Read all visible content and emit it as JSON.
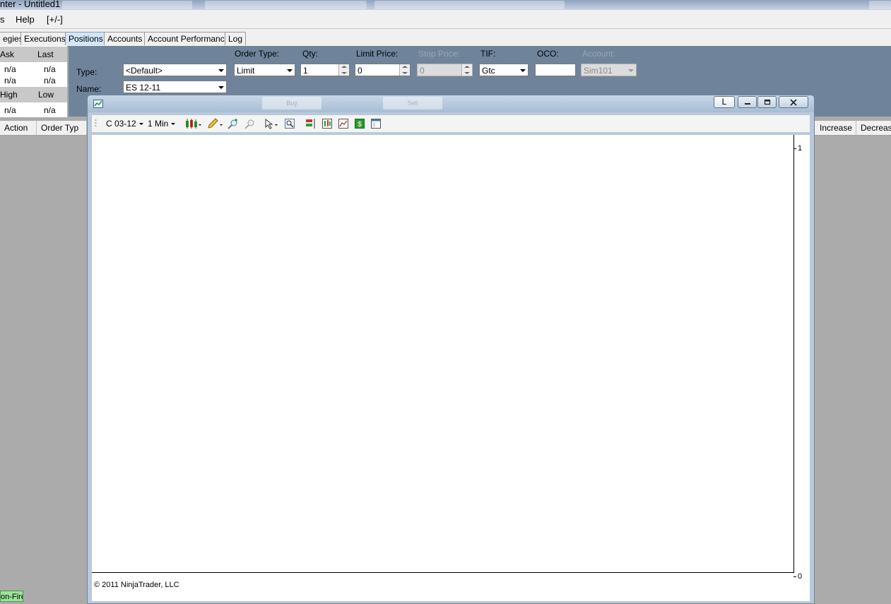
{
  "window": {
    "title": "nter - Untitled1",
    "taskbar_ghosts": [
      "",
      "",
      "",
      ""
    ]
  },
  "menu": {
    "items": [
      "s",
      "Help",
      "[+/-]"
    ]
  },
  "tabs": {
    "items": [
      "egies",
      "Executions",
      "Positions",
      "Accounts",
      "Account Performance",
      "Log"
    ],
    "active": "Positions"
  },
  "quote": {
    "headers1": [
      "Ask",
      "Last"
    ],
    "row1": [
      "n/a",
      "n/a"
    ],
    "row2": [
      "n/a",
      "n/a"
    ],
    "headers2": [
      "High",
      "Low"
    ],
    "row3": [
      "n/a",
      "n/a"
    ]
  },
  "order": {
    "type_label": "Type:",
    "type_value": "<Default>",
    "name_label": "Name:",
    "name_value": "ES 12-11",
    "order_type_label": "Order Type:",
    "order_type_value": "Limit",
    "qty_label": "Qty:",
    "qty_value": "1",
    "limit_price_label": "Limit Price:",
    "limit_price_value": "0",
    "stop_price_label": "Stop Price:",
    "stop_price_value": "0",
    "tif_label": "TIF:",
    "tif_value": "Gtc",
    "oco_label": "OCO:",
    "oco_value": "",
    "account_label": "Account:",
    "account_value": "Sim101",
    "buy_label": "Buy",
    "sell_label": "Sell"
  },
  "grid": {
    "headers_left": [
      "Action",
      "Order Typ"
    ],
    "headers_right": [
      "Increase",
      "Decrease"
    ]
  },
  "chart_window": {
    "link_button": "L",
    "instrument": "C 03-12",
    "interval": "1 Min",
    "axis_top": "1",
    "axis_bottom": "0",
    "copyright": "© 2011 NinjaTrader, LLC"
  },
  "status": {
    "chip": "on-Fire"
  },
  "colors": {
    "order_panel": "#6f849b",
    "active_tab": "#cfe6fb",
    "status_chip": "#9be29b"
  }
}
